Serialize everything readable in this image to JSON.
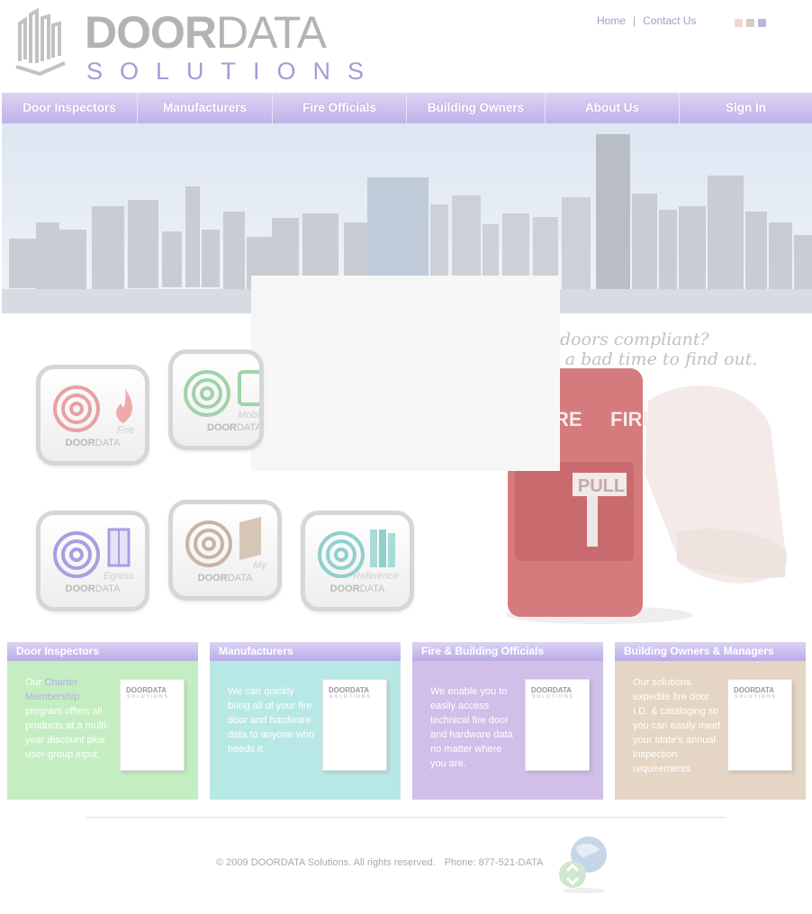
{
  "header": {
    "logo_left": "DOOR",
    "logo_right": "DATA",
    "logo_sub": "SOLUTIONS",
    "links": [
      "Home",
      "Contact Us"
    ],
    "link_separator": "|",
    "swatch_colors": [
      "#f3d6d6",
      "#d6ccc4",
      "#b8b4e6"
    ]
  },
  "nav": {
    "items": [
      "Door Inspectors",
      "Manufacturers",
      "Fire Officials",
      "Building Owners",
      "About Us",
      "Sign In"
    ]
  },
  "hero": {
    "tagline_line1": "doors compliant?",
    "tagline_line2": "s a bad time to find out."
  },
  "apps": [
    {
      "name": "Fire",
      "brand_a": "DOOR",
      "brand_b": "DATA",
      "color": "#e8a0a4"
    },
    {
      "name": "Mobi",
      "brand_a": "DOOR",
      "brand_b": "DATA",
      "color": "#9fd3a8"
    },
    {
      "name": "Egress",
      "brand_a": "DOOR",
      "brand_b": "DATA",
      "color": "#a99ee0"
    },
    {
      "name": "My",
      "brand_a": "DOOR",
      "brand_b": "DATA",
      "color": "#c8b4a4"
    },
    {
      "name": "Reference",
      "brand_a": "DOOR",
      "brand_b": "DATA",
      "color": "#8fd0cc"
    }
  ],
  "alarm": {
    "label_left": "RE",
    "label_right": "FIRE",
    "pull": "PULL"
  },
  "boxes": [
    {
      "title": "Door Inspectors",
      "color": "#c4eec1",
      "text_before": "Our ",
      "highlight": "Charter Membership",
      "text_after": " program offers all products at a multi-year discount plus user-group input."
    },
    {
      "title": "Manufacturers",
      "color": "#b8e8e5",
      "text": "We can quickly bring all of your fire door and hardware data to anyone who needs it."
    },
    {
      "title": "Fire & Building Officials",
      "color": "#cfbfe9",
      "text": "We enable you to easily access technical fire door and hardware data no matter where you are."
    },
    {
      "title": "Building Owners & Managers",
      "color": "#e4d5c4",
      "text": "Our solutions expedite fire door I.D. & cataloging so you can easily meet your state's annual inspection requirements."
    }
  ],
  "product_box": {
    "brand": "DOORDATA",
    "sub": "SOLUTIONS"
  },
  "footer": {
    "copyright": "© 2009 DOORDATA Solutions. All rights reserved.",
    "phone": "Phone: 877-521-DATA"
  }
}
